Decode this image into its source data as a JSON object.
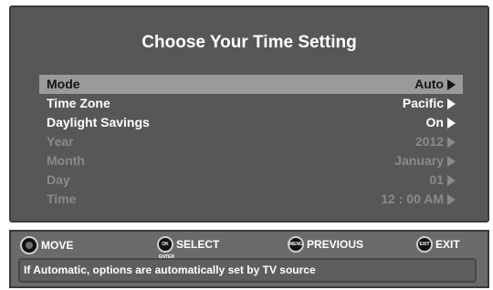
{
  "title": "Choose Your Time Setting",
  "menu": [
    {
      "label": "Mode",
      "value": "Auto",
      "state": "selected"
    },
    {
      "label": "Time Zone",
      "value": "Pacific",
      "state": "active"
    },
    {
      "label": "Daylight Savings",
      "value": "On",
      "state": "active"
    },
    {
      "label": "Year",
      "value": "2012",
      "state": "inactive"
    },
    {
      "label": "Month",
      "value": "January",
      "state": "inactive"
    },
    {
      "label": "Day",
      "value": "01",
      "state": "inactive"
    },
    {
      "label": "Time",
      "value": "12 : 00 AM",
      "state": "inactive"
    }
  ],
  "legend": {
    "move": "MOVE",
    "select": "SELECT",
    "previous": "PREVIOUS",
    "exit": "EXIT",
    "ok_icon": "OK ENTER",
    "menu_icon": "MENU",
    "exit_icon": "EXIT"
  },
  "message": "If Automatic, options are automatically set by TV source",
  "colors": {
    "screen_bg": "#575757",
    "selected_bg": "#9a9a9a",
    "active_text": "#ffffff",
    "inactive_text": "#8a8a8a",
    "bar_bg": "#6a6a6a"
  }
}
